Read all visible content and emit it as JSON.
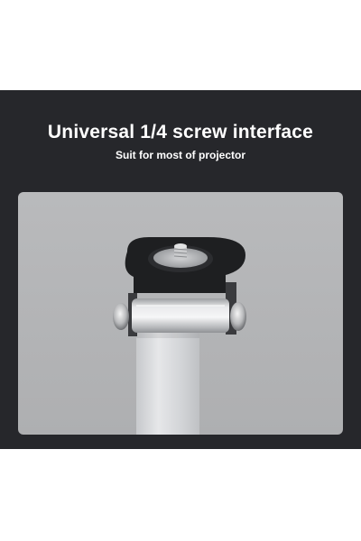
{
  "header": {
    "title": "Universal 1/4 screw interface",
    "subtitle": "Suit for most of projector"
  },
  "photo": {
    "subject": "projector-mount-screw-detail-photo",
    "background_color": "#b4b5b7",
    "banner_color": "#26272b"
  }
}
